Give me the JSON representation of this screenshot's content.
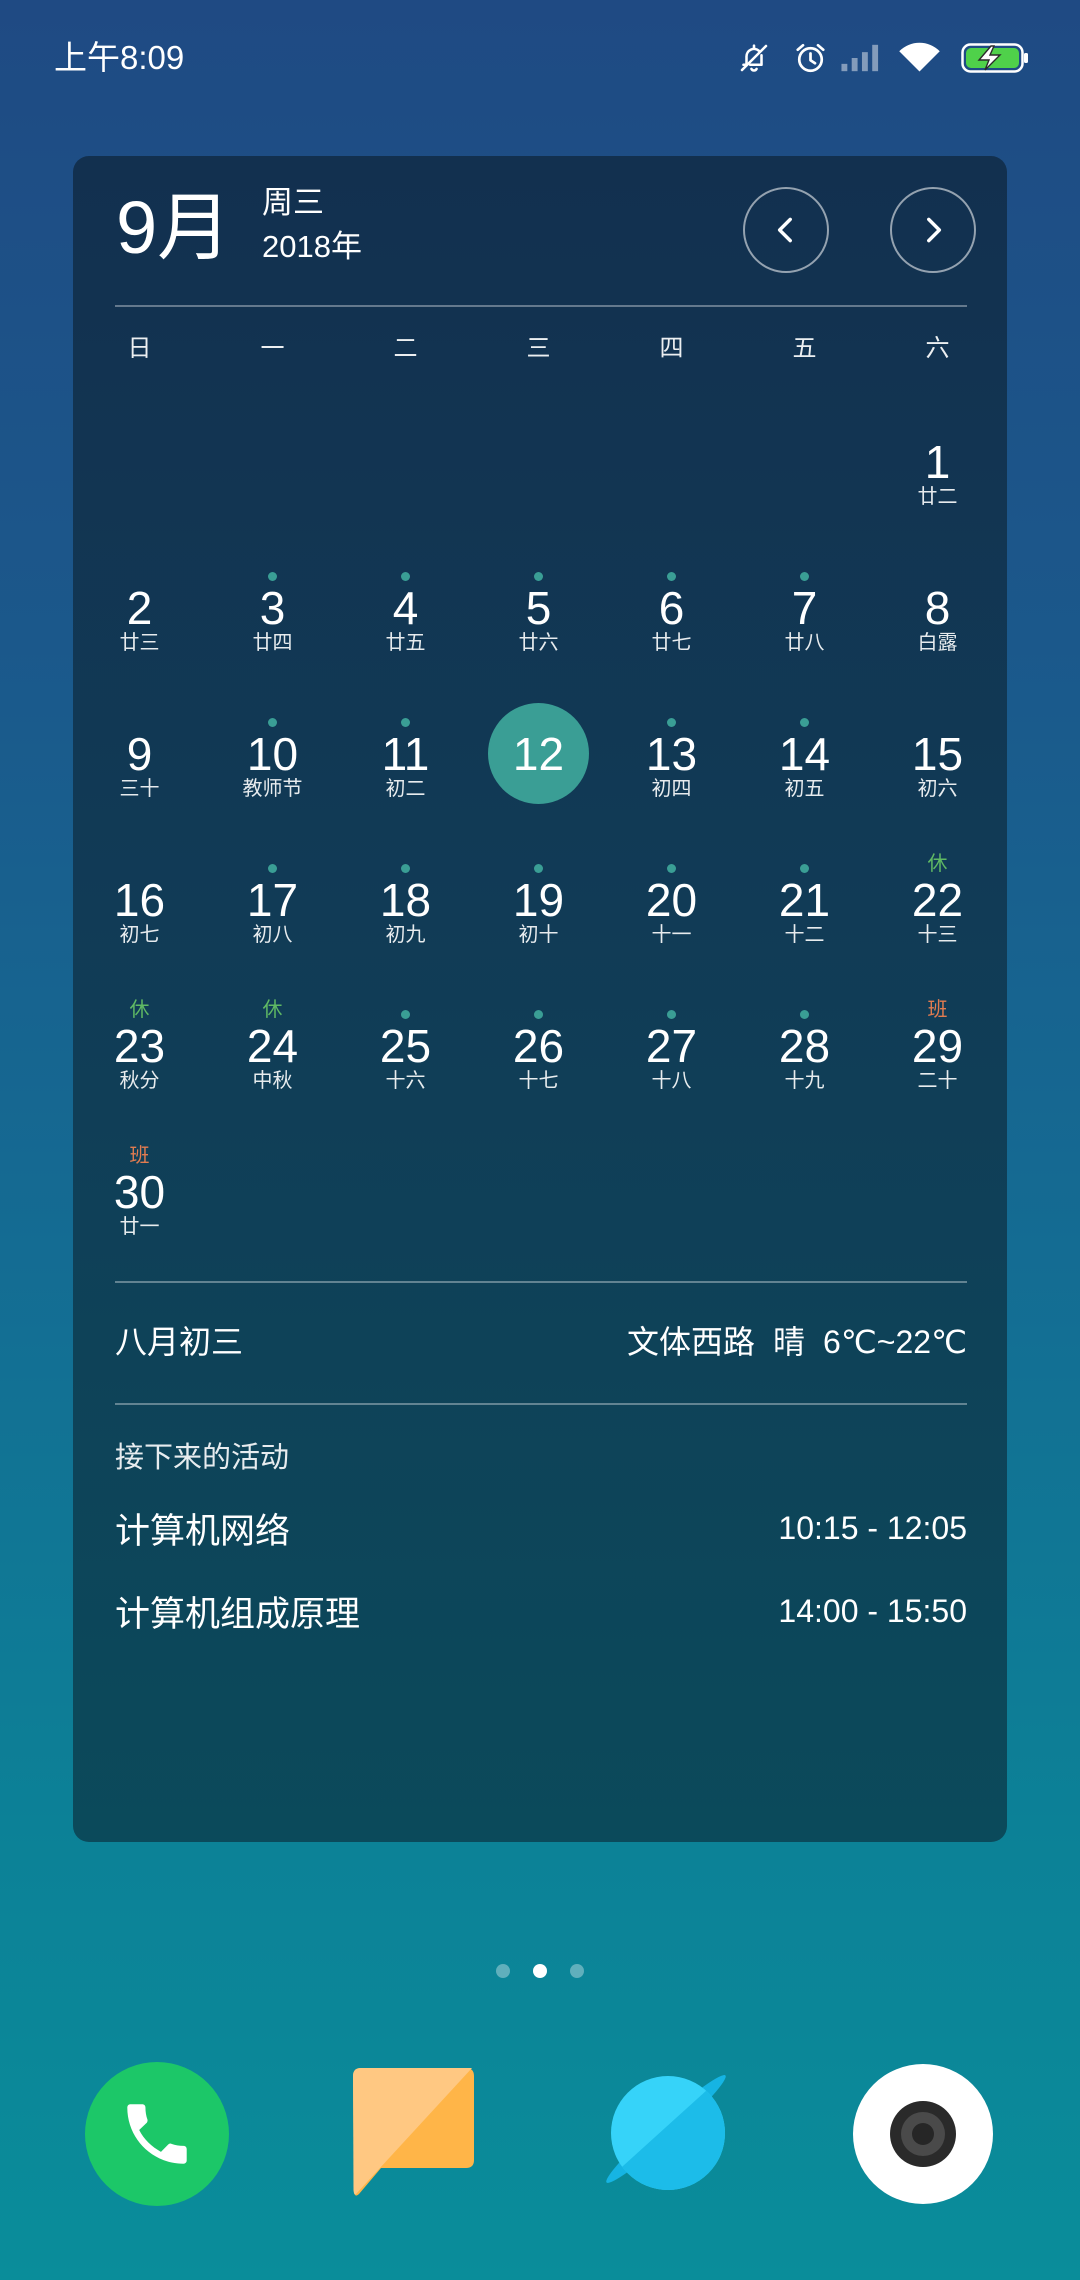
{
  "status_bar": {
    "time": "上午8:09",
    "icons": [
      "mute-icon",
      "alarm-icon",
      "signal-icon",
      "wifi-icon",
      "battery-charging-icon"
    ]
  },
  "colors": {
    "accent": "#3a9e95",
    "badge": {
      "休": "#5fb964",
      "班": "#e27c50"
    }
  },
  "calendar": {
    "month": "9月",
    "weekday": "周三",
    "year": "2018年",
    "nav_icons": [
      "chevron-left-icon",
      "chevron-right-icon"
    ],
    "weekday_headers": [
      "日",
      "一",
      "二",
      "三",
      "四",
      "五",
      "六"
    ],
    "weeks": [
      [
        null,
        null,
        null,
        null,
        null,
        null,
        {
          "day": "1",
          "lunar": "廿二"
        }
      ],
      [
        {
          "day": "2",
          "lunar": "廿三"
        },
        {
          "day": "3",
          "lunar": "廿四",
          "event_dot": true
        },
        {
          "day": "4",
          "lunar": "廿五",
          "event_dot": true
        },
        {
          "day": "5",
          "lunar": "廿六",
          "event_dot": true
        },
        {
          "day": "6",
          "lunar": "廿七",
          "event_dot": true
        },
        {
          "day": "7",
          "lunar": "廿八",
          "event_dot": true
        },
        {
          "day": "8",
          "lunar": "白露"
        }
      ],
      [
        {
          "day": "9",
          "lunar": "三十"
        },
        {
          "day": "10",
          "lunar": "教师节",
          "event_dot": true
        },
        {
          "day": "11",
          "lunar": "初二",
          "event_dot": true
        },
        {
          "day": "12",
          "selected": true
        },
        {
          "day": "13",
          "lunar": "初四",
          "event_dot": true
        },
        {
          "day": "14",
          "lunar": "初五",
          "event_dot": true
        },
        {
          "day": "15",
          "lunar": "初六"
        }
      ],
      [
        {
          "day": "16",
          "lunar": "初七"
        },
        {
          "day": "17",
          "lunar": "初八",
          "event_dot": true
        },
        {
          "day": "18",
          "lunar": "初九",
          "event_dot": true
        },
        {
          "day": "19",
          "lunar": "初十",
          "event_dot": true
        },
        {
          "day": "20",
          "lunar": "十一",
          "event_dot": true
        },
        {
          "day": "21",
          "lunar": "十二",
          "event_dot": true
        },
        {
          "day": "22",
          "lunar": "十三",
          "badge": "休"
        }
      ],
      [
        {
          "day": "23",
          "lunar": "秋分",
          "badge": "休"
        },
        {
          "day": "24",
          "lunar": "中秋",
          "badge": "休"
        },
        {
          "day": "25",
          "lunar": "十六",
          "event_dot": true
        },
        {
          "day": "26",
          "lunar": "十七",
          "event_dot": true
        },
        {
          "day": "27",
          "lunar": "十八",
          "event_dot": true
        },
        {
          "day": "28",
          "lunar": "十九",
          "event_dot": true
        },
        {
          "day": "29",
          "lunar": "二十",
          "badge": "班"
        }
      ],
      [
        {
          "day": "30",
          "lunar": "廿一",
          "badge": "班"
        }
      ]
    ],
    "lunar_date": "八月初三",
    "weather": {
      "location": "文体西路",
      "condition": "晴",
      "temperature": "6℃~22℃"
    },
    "upcoming_title": "接下来的活动",
    "events": [
      {
        "title": "计算机网络",
        "time": "10:15 - 12:05"
      },
      {
        "title": "计算机组成原理",
        "time": "14:00 - 15:50"
      }
    ]
  },
  "page_indicator": {
    "pages": 3,
    "current": 2
  },
  "dock": [
    {
      "icon": "phone-icon"
    },
    {
      "icon": "messages-icon"
    },
    {
      "icon": "browser-icon"
    },
    {
      "icon": "camera-icon"
    }
  ]
}
